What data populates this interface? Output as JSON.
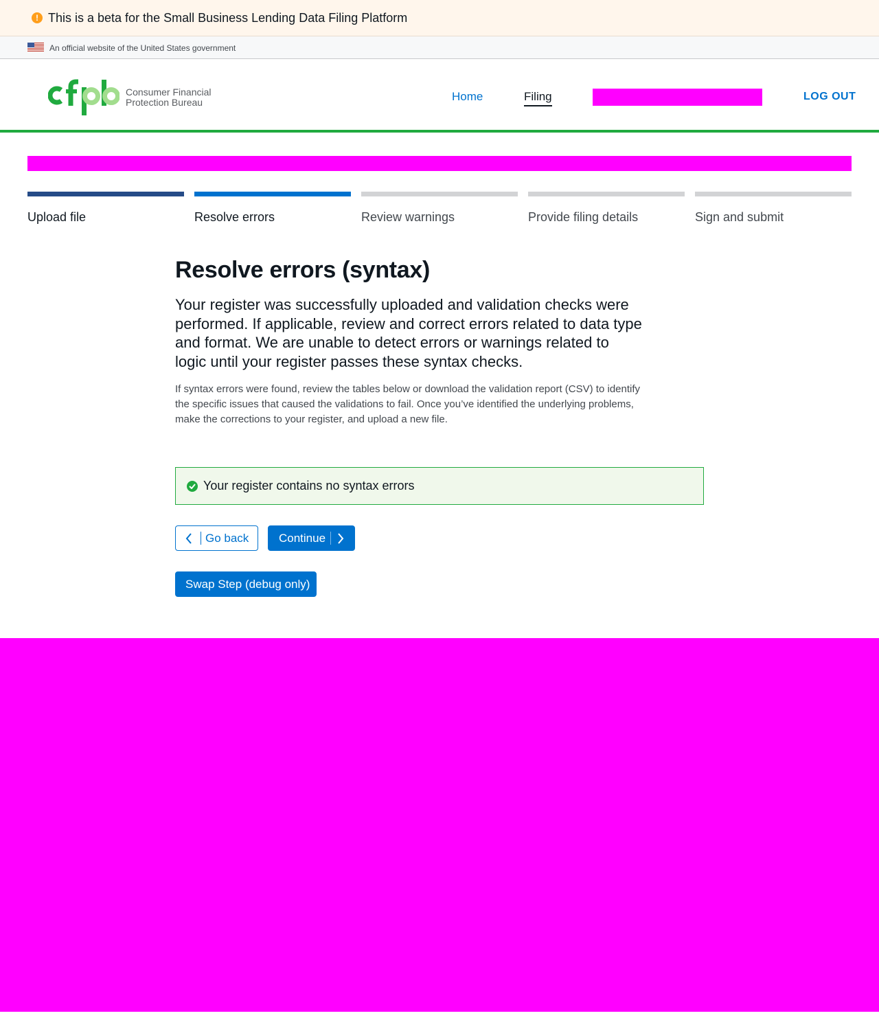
{
  "beta_banner": {
    "icon": "exclamation-circle-icon",
    "text": "This is a beta for the Small Business Lending Data Filing Platform",
    "color": "#ff9e1b"
  },
  "gov_banner": {
    "icon": "us-flag-icon",
    "text": "An official website of the United States government"
  },
  "header": {
    "logo_text_line1": "Consumer Financial",
    "logo_text_line2": "Protection Bureau",
    "nav": [
      {
        "label": "Home"
      },
      {
        "label": "Filing"
      }
    ],
    "logout_label": "LOG OUT",
    "accent_color": "#20aa3f"
  },
  "stepper": {
    "steps": [
      {
        "label": "Upload file",
        "status": "complete"
      },
      {
        "label": "Resolve errors",
        "status": "current"
      },
      {
        "label": "Review warnings",
        "status": "incomplete"
      },
      {
        "label": "Provide filing details",
        "status": "incomplete"
      },
      {
        "label": "Sign and submit",
        "status": "incomplete"
      }
    ]
  },
  "main": {
    "title": "Resolve errors (syntax)",
    "lead": "Your register was successfully uploaded and validation checks were performed. If applicable, review and correct errors related to data type and format. We are unable to detect errors or warnings related to logic until your register passes these syntax checks.",
    "body": "If syntax errors were found, review the tables below or download the validation report (CSV) to identify the specific issues that caused the validations to fail. Once you’ve identified the underlying problems, make the corrections to your register, and upload a new file.",
    "alert": {
      "icon": "check-circle-icon",
      "text": "Your register contains no syntax errors"
    },
    "buttons": {
      "back_label": "Go back",
      "continue_label": "Continue",
      "swap_label": "Swap Step (debug only)"
    }
  },
  "colors": {
    "primary": "#0072ce",
    "success": "#20aa3f",
    "redacted": "#ff00ff"
  }
}
